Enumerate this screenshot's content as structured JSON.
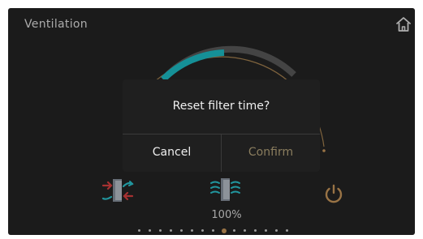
{
  "header": {
    "title": "Ventilation",
    "home_icon": "home-icon"
  },
  "gauge": {
    "value_fraction": 0.33,
    "fill_color": "#1ec8d2",
    "track_color": "#5f5f5f",
    "outer_ring_color": "#b08a55"
  },
  "dialog": {
    "message": "Reset filter time?",
    "cancel_label": "Cancel",
    "confirm_label": "Confirm"
  },
  "controls": {
    "exchange_icon": "air-exchange-icon",
    "fan_icon": "fan-speed-icon",
    "power_icon": "power-icon",
    "speed_label": "100%"
  },
  "pager": {
    "count": 15,
    "active_index": 8,
    "active_color": "#d4a060"
  }
}
